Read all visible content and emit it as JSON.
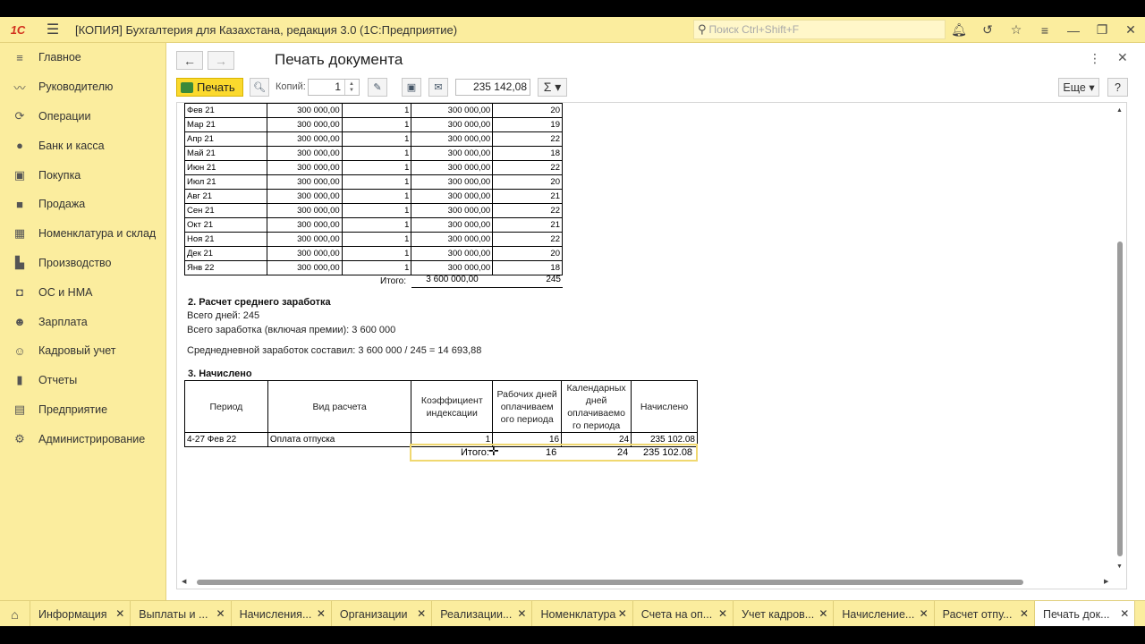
{
  "app": {
    "logo": "1С",
    "title": "[КОПИЯ] Бухгалтерия для Казахстана, редакция 3.0  (1С:Предприятие)",
    "search_placeholder": "Поиск Ctrl+Shift+F"
  },
  "sidebar": {
    "items": [
      {
        "label": "Главное",
        "icon": "menu-lines-icon"
      },
      {
        "label": "Руководителю",
        "icon": "trend-icon"
      },
      {
        "label": "Операции",
        "icon": "refresh-icon"
      },
      {
        "label": "Банк и касса",
        "icon": "coin-icon"
      },
      {
        "label": "Покупка",
        "icon": "cart-icon"
      },
      {
        "label": "Продажа",
        "icon": "bag-icon"
      },
      {
        "label": "Номенклатура и склад",
        "icon": "grid-icon"
      },
      {
        "label": "Производство",
        "icon": "factory-icon"
      },
      {
        "label": "ОС и НМА",
        "icon": "car-icon"
      },
      {
        "label": "Зарплата",
        "icon": "people-icon"
      },
      {
        "label": "Кадровый учет",
        "icon": "person-icon"
      },
      {
        "label": "Отчеты",
        "icon": "chart-icon"
      },
      {
        "label": "Предприятие",
        "icon": "document-icon"
      },
      {
        "label": "Администрирование",
        "icon": "gear-icon"
      }
    ]
  },
  "document": {
    "title": "Печать документа",
    "print_label": "Печать",
    "copies_label": "Копий:",
    "copies_value": "1",
    "sum_value": "235 142,08",
    "sigma_label": "Σ ▾",
    "more_label": "Еще ▾",
    "help_label": "?"
  },
  "report": {
    "table1_rows": [
      [
        "Фев 21",
        "300 000,00",
        "1",
        "300 000,00",
        "20"
      ],
      [
        "Мар 21",
        "300 000,00",
        "1",
        "300 000,00",
        "19"
      ],
      [
        "Апр 21",
        "300 000,00",
        "1",
        "300 000,00",
        "22"
      ],
      [
        "Май 21",
        "300 000,00",
        "1",
        "300 000,00",
        "18"
      ],
      [
        "Июн 21",
        "300 000,00",
        "1",
        "300 000,00",
        "22"
      ],
      [
        "Июл 21",
        "300 000,00",
        "1",
        "300 000,00",
        "20"
      ],
      [
        "Авг 21",
        "300 000,00",
        "1",
        "300 000,00",
        "21"
      ],
      [
        "Сен 21",
        "300 000,00",
        "1",
        "300 000,00",
        "22"
      ],
      [
        "Окт 21",
        "300 000,00",
        "1",
        "300 000,00",
        "21"
      ],
      [
        "Ноя 21",
        "300 000,00",
        "1",
        "300 000,00",
        "22"
      ],
      [
        "Дек 21",
        "300 000,00",
        "1",
        "300 000,00",
        "20"
      ],
      [
        "Янв 22",
        "300 000,00",
        "1",
        "300 000,00",
        "18"
      ]
    ],
    "table1_total_label": "Итого:",
    "table1_total_sum": "3 600 000,00",
    "table1_total_days": "245",
    "section2_title": "2. Расчет среднего  заработка",
    "section2_days": "Всего дней: 245",
    "section2_earnings": "Всего заработка (включая премии): 3 600 000",
    "section2_avg": "Среднедневной заработок составил: 3 600 000 / 245 = 14 693,88",
    "section3_title": "3. Начислено",
    "table3_headers": [
      "Период",
      "Вид расчета",
      "Коэффициент индексации",
      "Рабочих дней оплачиваем ого периода",
      "Календарных дней оплачиваемо го периода",
      "Начислено"
    ],
    "table3_row": [
      "4-27 Фев 22",
      "Оплата отпуска",
      "1",
      "16",
      "24",
      "235 102.08"
    ],
    "table3_total": {
      "label": "Итого:",
      "work_days": "16",
      "cal_days": "24",
      "amount": "235 102.08"
    }
  },
  "tabs": [
    {
      "label": "Информация"
    },
    {
      "label": "Выплаты и ..."
    },
    {
      "label": "Начисления..."
    },
    {
      "label": "Организации"
    },
    {
      "label": "Реализации..."
    },
    {
      "label": "Номенклатура"
    },
    {
      "label": "Счета на оп..."
    },
    {
      "label": "Учет кадров..."
    },
    {
      "label": "Начисление..."
    },
    {
      "label": "Расчет отпу..."
    },
    {
      "label": "Печать док..."
    }
  ],
  "colors": {
    "panel": "#fbed9e",
    "print_button": "#fbd92d",
    "logo": "#d2311e"
  }
}
